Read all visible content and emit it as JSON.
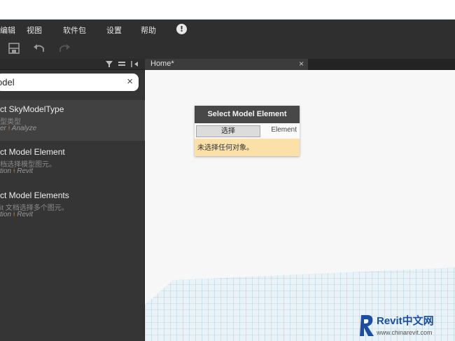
{
  "menu": {
    "items": [
      "编辑",
      "视图",
      "软件包",
      "设置",
      "帮助"
    ],
    "info_glyph": "!"
  },
  "toolbar": {
    "buttons": [
      "save-icon",
      "undo-icon",
      "redo-icon"
    ]
  },
  "library": {
    "header_icons": [
      "filter-icon",
      "list-view-icon",
      "collapse-icon"
    ],
    "search_value": "odel",
    "search_clear": "×",
    "results": [
      {
        "title": "ct SkyModelType",
        "description": "型类型",
        "category": "er",
        "arrow": "⟊",
        "subcategory": "Analyze"
      },
      {
        "title": "ct Model Element",
        "description": "档选择模型图元。",
        "category": "tion",
        "arrow": "⟊",
        "subcategory": "Revit"
      },
      {
        "title": "ct Model Elements",
        "description": "it 文档选择多个图元。",
        "category": "tion",
        "arrow": "⟊",
        "subcategory": "Revit"
      }
    ]
  },
  "workspace": {
    "tab_label": "Home*",
    "tab_close": "×"
  },
  "node": {
    "title": "Select Model Element",
    "button_label": "选择",
    "output_port": "Element",
    "message": "未选择任何对象。"
  },
  "watermark": {
    "text": "Revit中文网",
    "url": "www.chinarevit.com"
  },
  "colors": {
    "menubar": "#2f2f2f",
    "sidebar": "#353535",
    "node_header": "#484848",
    "node_footer": "#fbe0a8",
    "grid_line": "#8fb8cc",
    "brand": "#1a4fa3"
  }
}
